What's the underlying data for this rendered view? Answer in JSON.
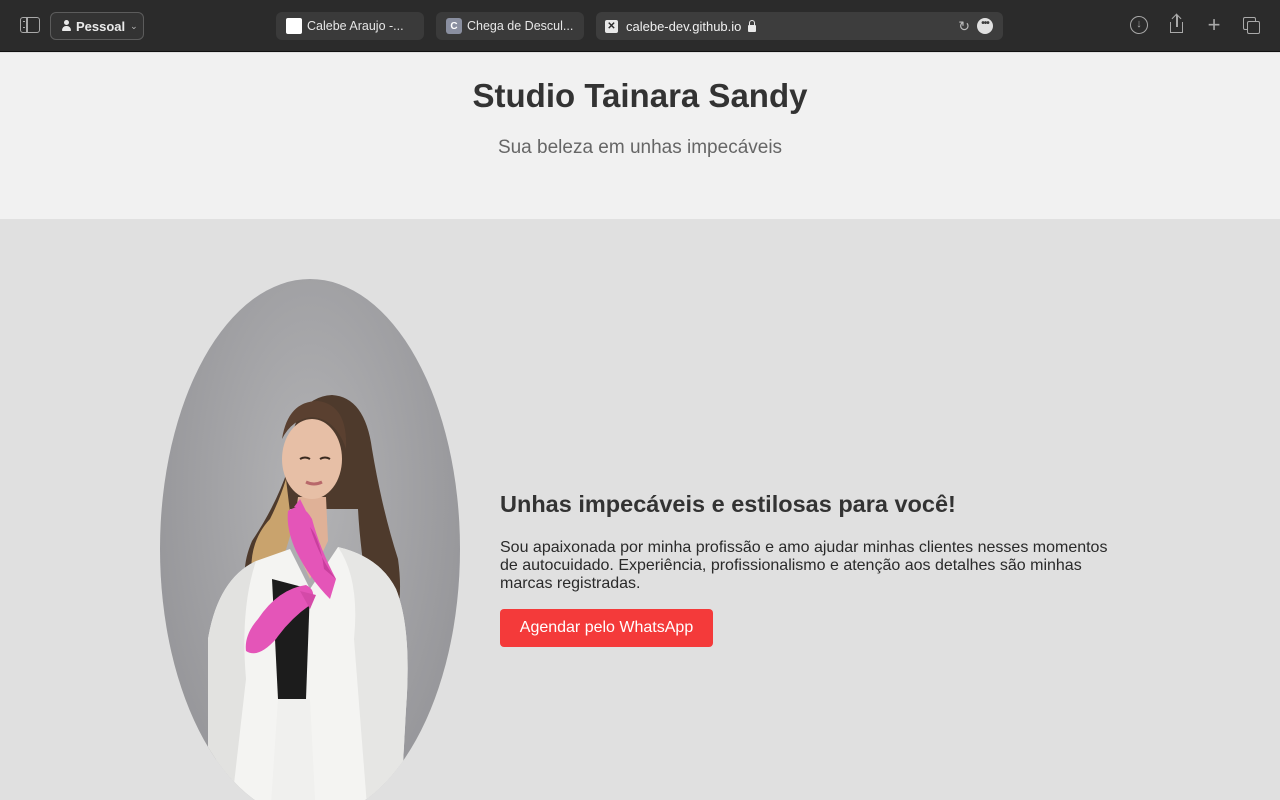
{
  "browser": {
    "profile_label": "Pessoal",
    "tabs": [
      {
        "title": "Calebe Araujo -..."
      },
      {
        "title": "Chega de Descul...",
        "favicon_letter": "C"
      }
    ],
    "address": "calebe-dev.github.io",
    "active_favicon_letter": "✕"
  },
  "header": {
    "title": "Studio Tainara Sandy",
    "subtitle": "Sua beleza em unhas impecáveis"
  },
  "hero": {
    "heading": "Unhas impecáveis e estilosas para você!",
    "text": "Sou apaixonada por minha profissão e amo ajudar minhas clientes nesses momentos de autocuidado. Experiência, profissionalismo e atenção aos detalhes são minhas marcas registradas.",
    "button_label": "Agendar pelo WhatsApp",
    "photo_icon": "portrait-photo"
  },
  "colors": {
    "toolbar_bg": "#2b2b2b",
    "header_bg": "#f1f1f1",
    "hero_bg": "#e0e0e0",
    "cta_bg": "#f43a3a",
    "glove_pink": "#e455b8"
  }
}
